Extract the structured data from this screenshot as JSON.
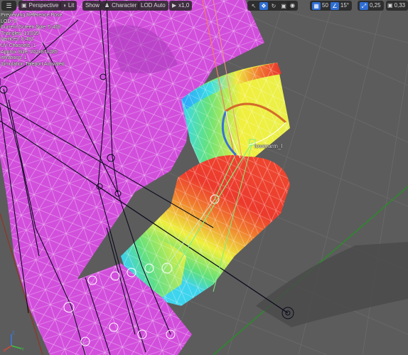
{
  "toolbar": {
    "menu_icon": "hamburger-menu-icon",
    "perspective_label": "Perspective",
    "lit_label": "Lit",
    "show_label": "Show",
    "character_label": "Character",
    "lod_label": "LOD Auto",
    "playback_speed_label": "x1,0",
    "grid_snap_value": "50",
    "rotation_snap_value": "15°",
    "scale_snap_value": "0,25",
    "camera_speed_value": "0,33"
  },
  "info_overlay": {
    "lines": [
      "Previewing Reference Pose",
      "LOD: 0",
      "Current Screen Size: 5.408",
      "Triangles: 13,819",
      "Vertices: 8,482",
      "UV Channels: 1",
      "Approx Size: 202x87x285",
      "Iterations: 1",
      "Simulation Teleport Activated"
    ]
  },
  "bone_label": "lowerarm_l",
  "colors": {
    "background": "#5c5c5c",
    "mesh_magenta": "#d24fdc",
    "heat_red": "#ee3a2c",
    "heat_yellow": "#f2f03c",
    "heat_green": "#4fe06a",
    "heat_cyan": "#39d6e6",
    "grid_green": "#2c7a2c",
    "grid_red": "#8a3a2a",
    "accent_blue": "#2f6ed3"
  }
}
